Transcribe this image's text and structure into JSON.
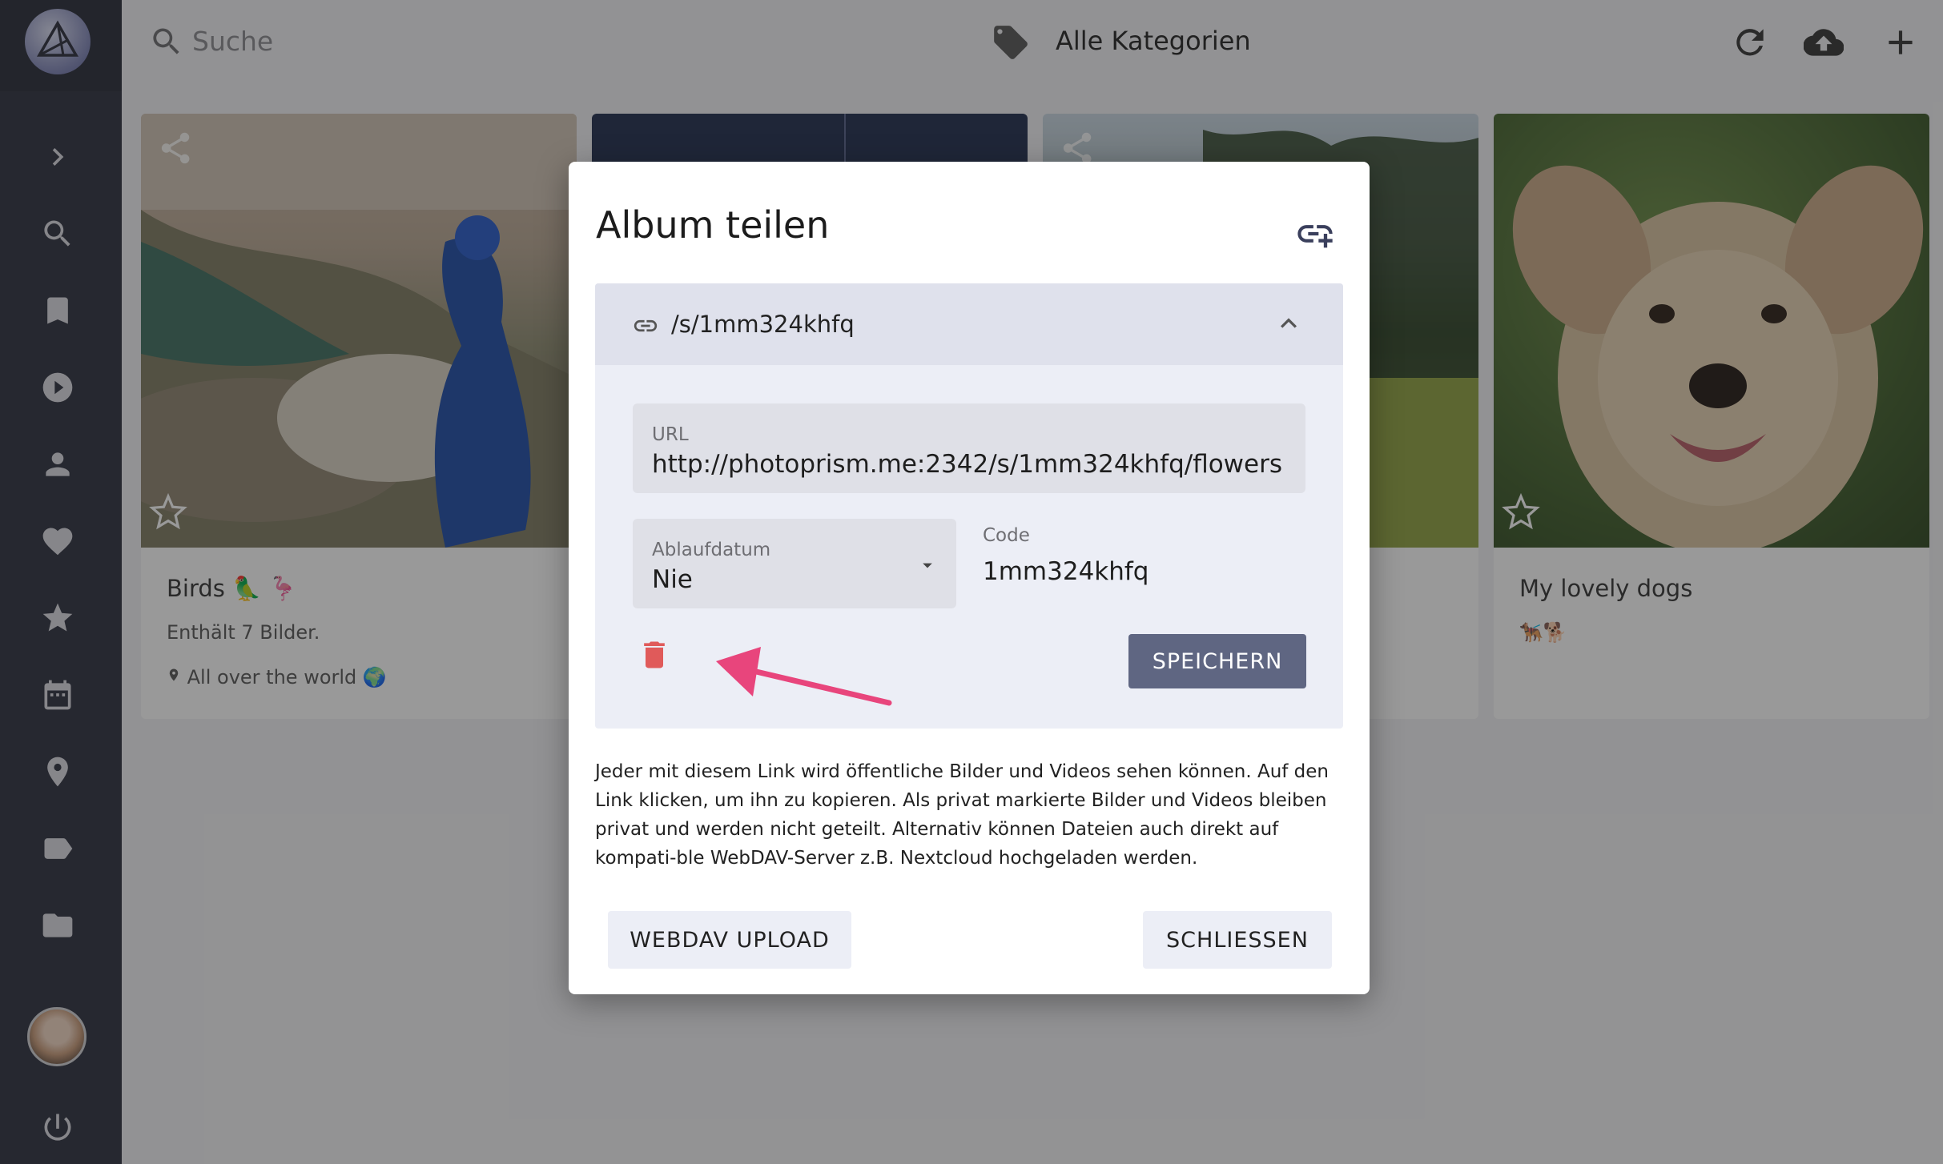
{
  "topbar": {
    "search_placeholder": "Suche",
    "category_label": "Alle Kategorien"
  },
  "albums": [
    {
      "title": "Birds 🦜 🦩",
      "subtitle": "Enthält 7 Bilder.",
      "location": "All over the world 🌍"
    },
    {
      "title": "",
      "subtitle": "",
      "location": ""
    },
    {
      "title": "",
      "subtitle": "",
      "location": ""
    },
    {
      "title": "My lovely dogs",
      "subtitle": "🐕‍🦺🐕",
      "location": ""
    }
  ],
  "dialog": {
    "title": "Album teilen",
    "link_path": "/s/1mm324khfq",
    "url_label": "URL",
    "url_value": "http://photoprism.me:2342/s/1mm324khfq/flowers",
    "expiry_label": "Ablaufdatum",
    "expiry_value": "Nie",
    "code_label": "Code",
    "code_value": "1mm324khfq",
    "save_label": "SPEICHERN",
    "description": "Jeder mit diesem Link wird öffentliche Bilder und Videos sehen können. Auf den Link klicken, um ihn zu kopieren. Als privat markierte Bilder und Videos bleiben privat und werden nicht geteilt. Alternativ können Dateien auch direkt auf kompati-ble WebDAV-Server z.B. Nextcloud hochgeladen werden.",
    "webdav_label": "WEBDAV UPLOAD",
    "close_label": "SCHLIESSEN"
  },
  "colors": {
    "sidebar": "#2c2f3e",
    "save_button": "#5f6682",
    "delete_icon": "#e05a5a",
    "arrow": "#e8457c"
  }
}
